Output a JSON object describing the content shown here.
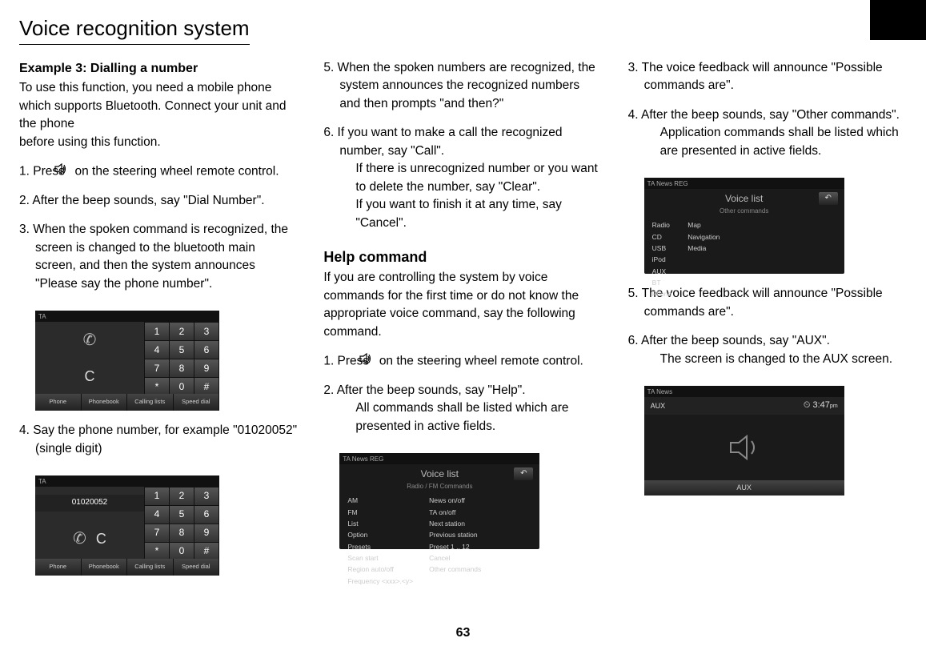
{
  "page_title": "Voice recognition system",
  "page_number": "63",
  "col1": {
    "heading": "Example 3: Dialling a number",
    "intro1": "To use this function, you need a mobile phone which supports Bluetooth. Connect your unit and the phone",
    "intro2": "before using this function.",
    "s1a": "1. Press ",
    "s1b": " on the steering wheel remote control.",
    "s2": "2. After the beep sounds, say \"Dial Number\".",
    "s3": "3. When the spoken command is recognized, the screen is changed to the bluetooth main screen, and then the system announces \"Please say the phone number\".",
    "s4": "4. Say the phone number, for example \"01020052\" (single digit)"
  },
  "col2": {
    "s5": "5. When the spoken numbers are recognized, the system announces the recognized numbers and then prompts \"and then?\"",
    "s6a": "6. If you want to make a call the recognized number, say \"Call\".",
    "s6b": "If there is unrecognized number or you want to delete the number, say \"Clear\".",
    "s6c": "If you want to finish it at any time, say \"Cancel\".",
    "heading2": "Help command",
    "intro2": "If you are controlling the system by voice commands for the first time or do not know the appropriate voice command, say the following command.",
    "h1a": "1. Press ",
    "h1b": " on the steering wheel remote control.",
    "h2a": "2. After the beep sounds, say \"Help\".",
    "h2b": "All commands shall be listed which are presented in active fields."
  },
  "col3": {
    "s3": "3. The voice feedback will announce \"Possible commands are\".",
    "s4a": "4. After the beep sounds, say \"Other commands\".",
    "s4b": "Application commands shall be listed which are presented in active fields.",
    "s5": "5. The voice feedback will announce \"Possible commands are\".",
    "s6a": "6. After the beep sounds, say \"AUX\".",
    "s6b": "The screen is changed to the AUX screen."
  },
  "keypad1": {
    "topbar": "TA",
    "keys": [
      "1",
      "2",
      "3",
      "4",
      "5",
      "6",
      "7",
      "8",
      "9",
      "*",
      "0",
      "#"
    ],
    "tabs": [
      "Phone",
      "Phonebook",
      "Calling lists",
      "Speed dial"
    ],
    "clear": "C"
  },
  "keypad2": {
    "topbar": "TA",
    "number": "01020052",
    "keys": [
      "1",
      "2",
      "3",
      "4",
      "5",
      "6",
      "7",
      "8",
      "9",
      "*",
      "0",
      "#"
    ],
    "tabs": [
      "Phone",
      "Phonebook",
      "Calling lists",
      "Speed dial"
    ],
    "clear": "C"
  },
  "voicelist1": {
    "topbar": "TA   News   REG",
    "title": "Voice list",
    "subtitle": "Radio / FM Commands",
    "left": [
      "AM",
      "FM",
      "List",
      "Option",
      "Presets",
      "Scan start",
      "Region auto/off",
      "Frequency <xxx>.<y>"
    ],
    "right": [
      "News on/off",
      "TA on/off",
      "Next station",
      "Previous station",
      "Preset 1 .. 12",
      "Cancel",
      "Other commands"
    ],
    "back": "↶"
  },
  "voicelist2": {
    "topbar": "TA   News   REG",
    "title": "Voice list",
    "subtitle": "Other commands",
    "left": [
      "Radio",
      "CD",
      "USB",
      "iPod",
      "AUX",
      "BT",
      "Phone"
    ],
    "right": [
      "Map",
      "Navigation",
      "Media"
    ],
    "back": "↶"
  },
  "aux": {
    "topbar": "TA   News",
    "label": "AUX",
    "time": "3:47",
    "tab": "AUX"
  }
}
